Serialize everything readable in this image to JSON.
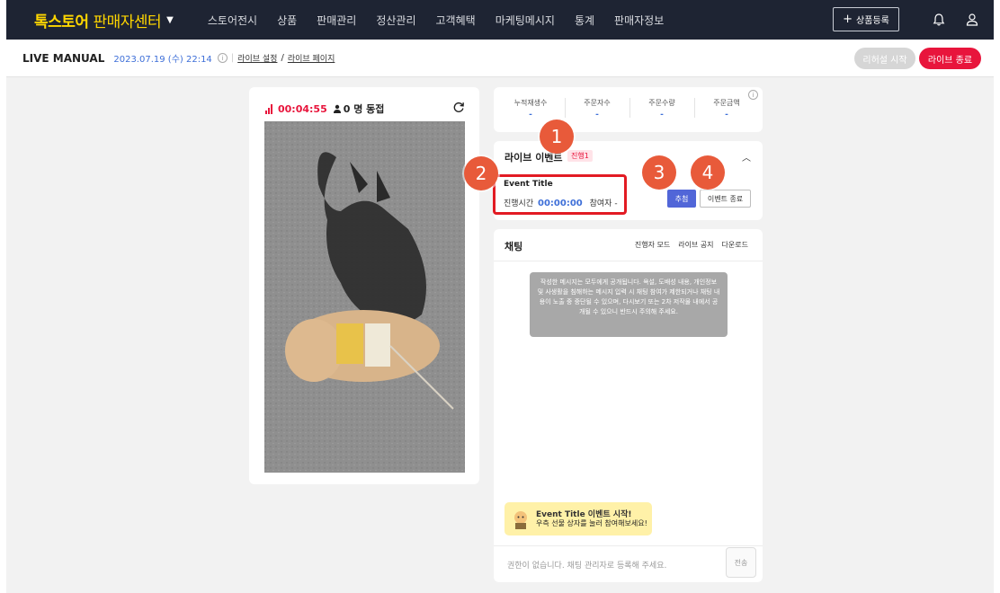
{
  "nav": {
    "brand_main": "톡스토어",
    "brand_sub": " 판매자센터",
    "menu": [
      "스토어전시",
      "상품",
      "판매관리",
      "정산관리",
      "고객혜택",
      "마케팅메시지",
      "통계",
      "판매자정보"
    ],
    "register_label": "상품등록"
  },
  "subbar": {
    "title": "LIVE MANUAL",
    "datetime": "2023.07.19 (수) 22:14",
    "link_settings": "라이브 설정",
    "link_separator": "/",
    "link_page": "라이브 페이지",
    "rehearsal_label": "리허설 시작",
    "end_label": "라이브 종료"
  },
  "video": {
    "elapsed": "00:04:55",
    "viewers": "0 명 동접"
  },
  "stats": [
    {
      "label": "누적재생수",
      "value": "-"
    },
    {
      "label": "주문자수",
      "value": "-"
    },
    {
      "label": "주문수량",
      "value": "-"
    },
    {
      "label": "주문금액",
      "value": "-"
    }
  ],
  "event": {
    "header": "라이브 이벤트",
    "status_badge": "진행1",
    "title": "Event Title",
    "time_label": "진행시간",
    "time_value": "00:00:00",
    "participants_label": "참여자 -",
    "draw_label": "추첨",
    "end_label": "이벤트 종료"
  },
  "chat": {
    "header": "채팅",
    "tools": [
      "진행자 모드",
      "라이브 공지",
      "다운로드"
    ],
    "notice": "작성한 메시지는 모두에게 공개됩니다. 욕설, 도배성 내용, 개인정보 및 사생활을 침해하는 메시지 입력 시 채팅 참여가 제한되거나 채팅 내용이 노출 중 중단될 수 있으며, 다시보기 또는 2차 저작물 내에서 공개될 수 있으니 반드시 주의해 주세요.",
    "toast_title": "Event Title 이벤트 시작!",
    "toast_body": "우측 선물 상자를 눌러 참여해보세요!",
    "input_placeholder": "권한이 없습니다. 채팅 관리자로 등록해 주세요.",
    "send_label": "전송"
  },
  "callouts": [
    "1",
    "2",
    "3",
    "4"
  ],
  "colors": {
    "nav_bg": "#1e2433",
    "brand": "#ffd600",
    "live_red": "#e8153c",
    "accent_blue": "#3e6fd8",
    "draw_button": "#5166d8",
    "callout": "#e85a3a",
    "highlight": "#e21b23"
  }
}
